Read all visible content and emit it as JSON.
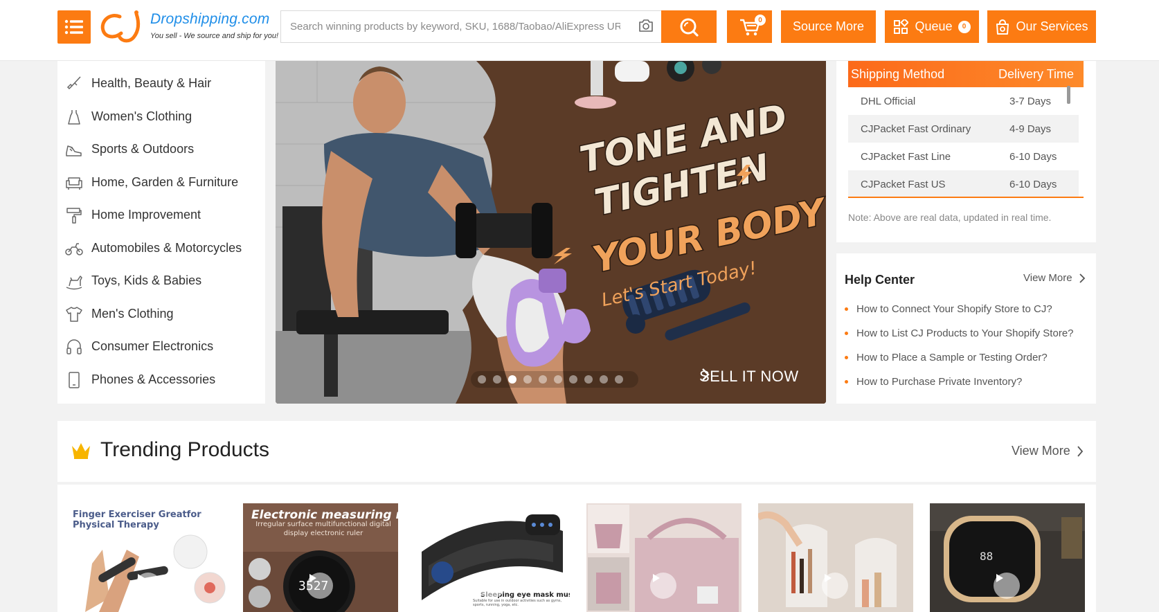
{
  "header": {
    "logo_brand": "Dropshipping.com",
    "logo_tagline": "You sell - We source and ship for you!",
    "search_placeholder": "Search winning products by keyword, SKU, 1688/Taobao/AliExpress URL",
    "cart_count": "0",
    "source_more_label": "Source More",
    "queue_label": "Queue",
    "queue_count": "0",
    "services_label": "Our Services",
    "accent_color": "#fc7b12"
  },
  "categories": [
    {
      "label": "Health, Beauty & Hair",
      "icon": "brush-icon"
    },
    {
      "label": "Women's Clothing",
      "icon": "dress-icon"
    },
    {
      "label": "Sports & Outdoors",
      "icon": "sneaker-icon"
    },
    {
      "label": "Home, Garden & Furniture",
      "icon": "sofa-icon"
    },
    {
      "label": "Home Improvement",
      "icon": "paint-roller-icon"
    },
    {
      "label": "Automobiles & Motorcycles",
      "icon": "motorcycle-icon"
    },
    {
      "label": "Toys, Kids & Babies",
      "icon": "rocking-horse-icon"
    },
    {
      "label": "Men's Clothing",
      "icon": "tshirt-icon"
    },
    {
      "label": "Consumer Electronics",
      "icon": "headphones-icon"
    },
    {
      "label": "Phones & Accessories",
      "icon": "phone-icon"
    }
  ],
  "banner": {
    "headline_1": "TONE AND",
    "headline_2": "TIGHTEN",
    "headline_3": "YOUR BODY",
    "subline": "Let's Start Today!",
    "cta": "SELL IT NOW",
    "slide_count": 10,
    "active_slide": 3
  },
  "shipping": {
    "col_method": "Shipping Method",
    "col_time": "Delivery Time",
    "rows": [
      {
        "method": "DHL Official",
        "time": "3-7 Days"
      },
      {
        "method": "CJPacket Fast Ordinary",
        "time": "4-9 Days"
      },
      {
        "method": "CJPacket Fast Line",
        "time": "6-10 Days"
      },
      {
        "method": "CJPacket Fast US",
        "time": "6-10 Days"
      }
    ],
    "note": "Note: Above are real data, updated in real time."
  },
  "help": {
    "title": "Help Center",
    "view_more": "View More",
    "items": [
      "How to Connect Your Shopify Store to CJ?",
      "How to List CJ Products to Your Shopify Store?",
      "How to Place a Sample or Testing Order?",
      "How to Purchase Private Inventory?"
    ]
  },
  "trending": {
    "title": "Trending Products",
    "view_more": "View More",
    "products": [
      {
        "caption_1": "Finger Exerciser Greatfor",
        "caption_2": "Physical Therapy"
      },
      {
        "caption_1": "Electronic measuring rule",
        "caption_2": "Irregular surface multifunctional digital display electronic ruler",
        "screen": "3527"
      },
      {
        "caption_1": "Sleeping eye mask music",
        "caption_2": "Suitable for use in outdoor activities such as gyms, sports, running, yoga, etc."
      },
      {
        "caption_1": ""
      },
      {
        "caption_1": ""
      },
      {
        "caption_1": "",
        "screen": "88"
      }
    ]
  }
}
